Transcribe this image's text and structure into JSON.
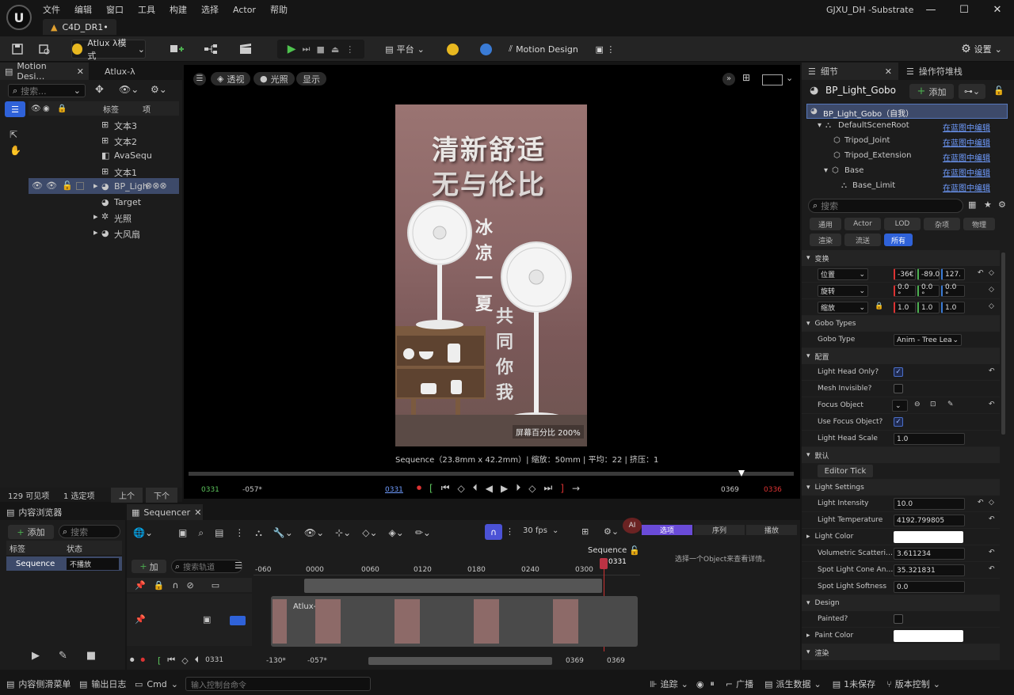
{
  "app": {
    "window_title": "GJXU_DH -Substrate",
    "doc_tab": "C4D_DR1•",
    "logo": "U"
  },
  "menu": [
    "文件",
    "编辑",
    "窗口",
    "工具",
    "构建",
    "选择",
    "Actor",
    "帮助"
  ],
  "toolbar": {
    "mode_label": "Atlux λ模式",
    "platform_label": "平台",
    "motion_design_label": "Motion Design",
    "settings_label": "设置"
  },
  "outliner": {
    "tab1": "Motion Desi…",
    "tab2": "Atlux-λ",
    "search_placeholder": "搜索...",
    "col_label": "标签",
    "col_item": "项",
    "items": [
      {
        "label": "文本3"
      },
      {
        "label": "文本2"
      },
      {
        "label": "AvaSequ"
      },
      {
        "label": "文本1"
      },
      {
        "label": "BP_Ligh"
      },
      {
        "label": "Target"
      },
      {
        "label": "光照"
      },
      {
        "label": "大风扇"
      }
    ],
    "status_visible": "129 可见项",
    "status_selected": "1 选定项",
    "btn_prev": "上个",
    "btn_next": "下个"
  },
  "viewport": {
    "btn_perspective": "透视",
    "btn_lit": "光照",
    "btn_show": "显示",
    "poster_title_line1": "清新舒适",
    "poster_title_line2": "无与伦比",
    "poster_vertical_1": "冰凉一夏",
    "poster_vertical_2": "共同你我",
    "screen_pct": "屏幕百分比 200%",
    "info_line": "Sequence（23.8mm x 42.2mm）| 缩放：50mm | 平均：22 | 挤压：1",
    "tl_start": "0331",
    "tl_prev": "-057*",
    "tl_cur": "0331",
    "tl_end": "0369",
    "tl_end2": "0336"
  },
  "details": {
    "tab1": "细节",
    "tab2": "操作符堆栈",
    "object_name": "BP_Light_Gobo",
    "add_label": "添加",
    "tree": [
      {
        "label": "BP_Light_Gobo（自我）",
        "link": ""
      },
      {
        "label": "DefaultSceneRoot",
        "link": "在蓝图中编辑"
      },
      {
        "label": "Tripod_Joint",
        "link": "在蓝图中编辑"
      },
      {
        "label": "Tripod_Extension",
        "link": "在蓝图中编辑"
      },
      {
        "label": "Base",
        "link": "在蓝图中编辑"
      },
      {
        "label": "Base_Limit",
        "link": "在蓝图中编辑"
      }
    ],
    "search_placeholder": "搜索",
    "filters_row1": [
      "通用",
      "Actor",
      "LOD",
      "杂项",
      "物理"
    ],
    "filters_row2": [
      "渲染",
      "流送",
      "所有"
    ],
    "sec_transform": "变换",
    "pos_label": "位置",
    "rot_label": "旋转",
    "scale_label": "缩放",
    "pos_vals": [
      "-36€",
      "-89.0",
      "127."
    ],
    "rot_vals": [
      "0.0 °",
      "0.0 °",
      "0.0 °"
    ],
    "scale_vals": [
      "1.0",
      "1.0",
      "1.0"
    ],
    "sec_gobo": "Gobo Types",
    "gobo_type_label": "Gobo Type",
    "gobo_type_val": "Anim - Tree Lea",
    "sec_config": "配置",
    "light_head_only": "Light Head Only?",
    "mesh_invisible": "Mesh Invisible?",
    "focus_object": "Focus Object",
    "use_focus": "Use Focus Object?",
    "light_head_scale": "Light Head Scale",
    "light_head_scale_val": "1.0",
    "sec_default": "默认",
    "editor_tick": "Editor Tick",
    "sec_light": "Light Settings",
    "light_intensity": "Light Intensity",
    "light_intensity_val": "10.0",
    "light_temp": "Light Temperature",
    "light_temp_val": "4192.799805",
    "light_color": "Light Color",
    "vol_scatter": "Volumetric Scatteri…",
    "vol_scatter_val": "3.611234",
    "cone_angle": "Spot Light Cone An…",
    "cone_angle_val": "35.321831",
    "softness": "Spot Light Softness",
    "softness_val": "0.0",
    "sec_design": "Design",
    "painted": "Painted?",
    "paint_color": "Paint Color",
    "sec_render": "渲染"
  },
  "content": {
    "tab1": "内容浏览器",
    "tab2": "Sequencer",
    "add": "添加",
    "search_ph": "搜索",
    "col_label": "标签",
    "col_status": "状态",
    "seq_name": "Sequence",
    "seq_status": "不播放"
  },
  "sequencer": {
    "fps": "30 fps",
    "seq_title": "Sequence",
    "playhead": "0331",
    "add_track": "加",
    "search_track_ph": "搜索轨道",
    "ruler": [
      "-060",
      "0000",
      "0060",
      "0120",
      "0180",
      "0240",
      "0300"
    ],
    "clip_label": "Atlux-…",
    "bottom_cur": "0331",
    "bottom_a": "-130*",
    "bottom_b": "-057*",
    "bottom_c": "0369",
    "bottom_d": "0369",
    "right_tabs": [
      "选项",
      "序列",
      "播放"
    ],
    "right_msg": "选择一个Object来查看详情。"
  },
  "statusbar": {
    "drawer": "内容侧滑菜单",
    "log": "输出日志",
    "cmd": "Cmd",
    "cmd_ph": "输入控制台命令",
    "trace": "追踪",
    "broadcast": "广播",
    "derived": "派生数据",
    "unsaved": "1未保存",
    "vc": "版本控制"
  }
}
